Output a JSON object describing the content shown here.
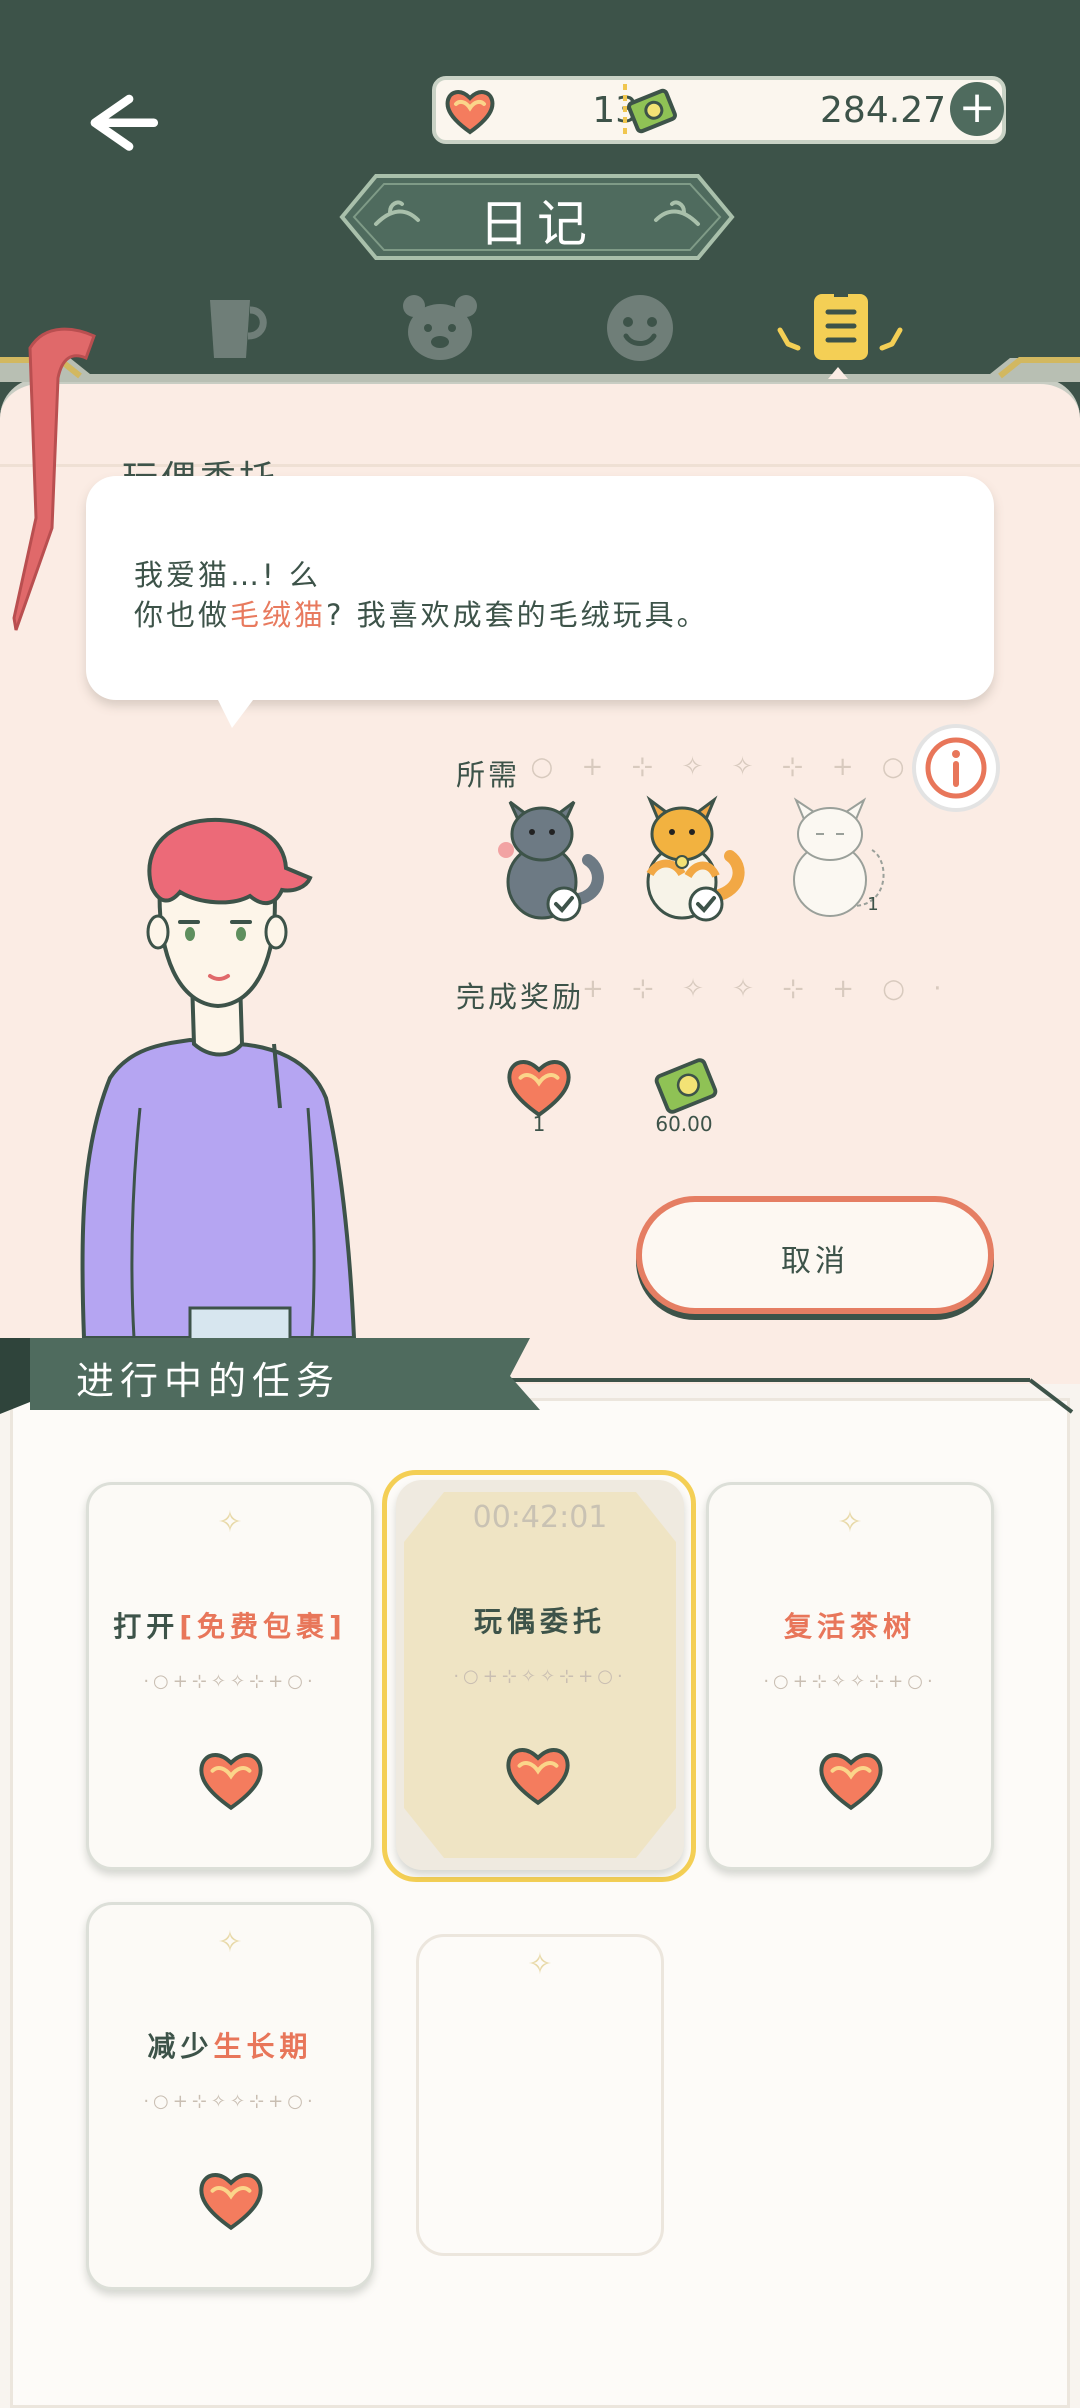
{
  "header": {
    "title": "日记",
    "hearts": "13",
    "cash": "284.27",
    "plus_label": "+"
  },
  "tabs": [
    {
      "icon": "cup-icon"
    },
    {
      "icon": "bear-icon"
    },
    {
      "icon": "face-icon"
    },
    {
      "icon": "diary-icon",
      "active": true
    }
  ],
  "detail": {
    "section_title": "玩偶委托",
    "dialog_line1": "我爱猫…!  么",
    "dialog_line2_pre": "你也做",
    "dialog_line2_highlight": "毛绒猫",
    "dialog_line2_post": "? 我喜欢成套的毛绒玩具。",
    "required_label": "所需",
    "required_deco": "· ○ + ⊹ ✧ ✧ ⊹ + ○ ·",
    "required_items": [
      {
        "name": "gray-cat",
        "checked": true
      },
      {
        "name": "orange-cat",
        "checked": true
      },
      {
        "name": "white-cat",
        "checked": false,
        "count": "1"
      }
    ],
    "reward_label": "完成奖励",
    "reward_deco": "+ ⊹ ✧ ✧ ⊹ + ○ ·",
    "reward_hearts": "1",
    "reward_cash": "60.00",
    "cancel_label": "取消"
  },
  "tasks": {
    "banner": "进行中的任务",
    "timer": "00:42:01",
    "card_deco": "·○+⊹✧✧⊹+○·",
    "card1": {
      "a": "打开",
      "b": "[免费包裹]"
    },
    "card2": {
      "a": "玩偶委托"
    },
    "card3": {
      "b": "复活茶树"
    },
    "card4": {
      "a": "减少",
      "b": "生长期"
    }
  },
  "colors": {
    "dark_green": "#3d5349",
    "accent_orange": "#e8765a",
    "panel_pink": "#fbece4",
    "gold": "#f4cf55"
  }
}
